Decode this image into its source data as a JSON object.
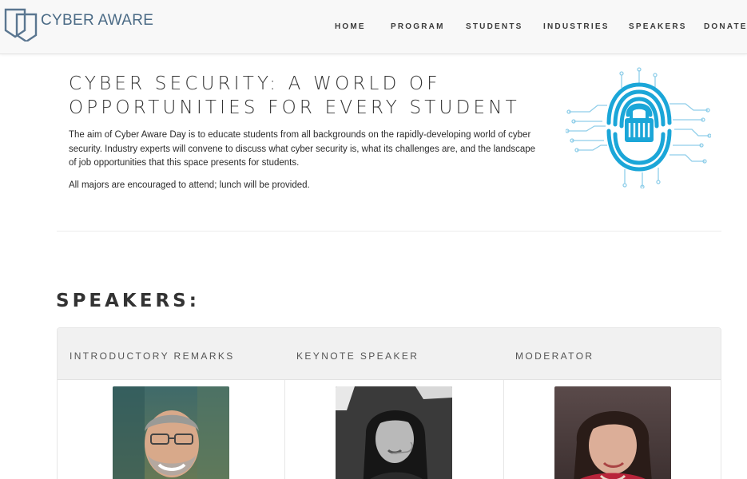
{
  "header": {
    "logo_text": "CYBER AWARE",
    "nav": [
      "HOME",
      "PROGRAM",
      "STUDENTS",
      "INDUSTRIES",
      "SPEAKERS",
      "DONATE"
    ]
  },
  "hero": {
    "title_line1": "CYBER SECURITY: A WORLD OF",
    "title_line2": "OPPORTUNITIES FOR EVERY STUDENT",
    "paragraph1": "The aim of Cyber Aware Day is to educate students from all backgrounds on the rapidly-developing world of cyber security. Industry experts will convene to discuss what cyber security is, what its challenges are, and the landscape of job opportunities that this space presents for students.",
    "paragraph2": "All majors are encouraged to attend; lunch will be provided.",
    "image_icon": "fingerprint-lock-icon"
  },
  "speakers": {
    "heading": "SPEAKERS:",
    "columns": [
      {
        "label": "INTRODUCTORY REMARKS"
      },
      {
        "label": "KEYNOTE SPEAKER"
      },
      {
        "label": "MODERATOR"
      }
    ]
  },
  "colors": {
    "accent": "#1ba6d8",
    "logo": "#4a6a85",
    "header_bg": "#f8f8f8"
  }
}
